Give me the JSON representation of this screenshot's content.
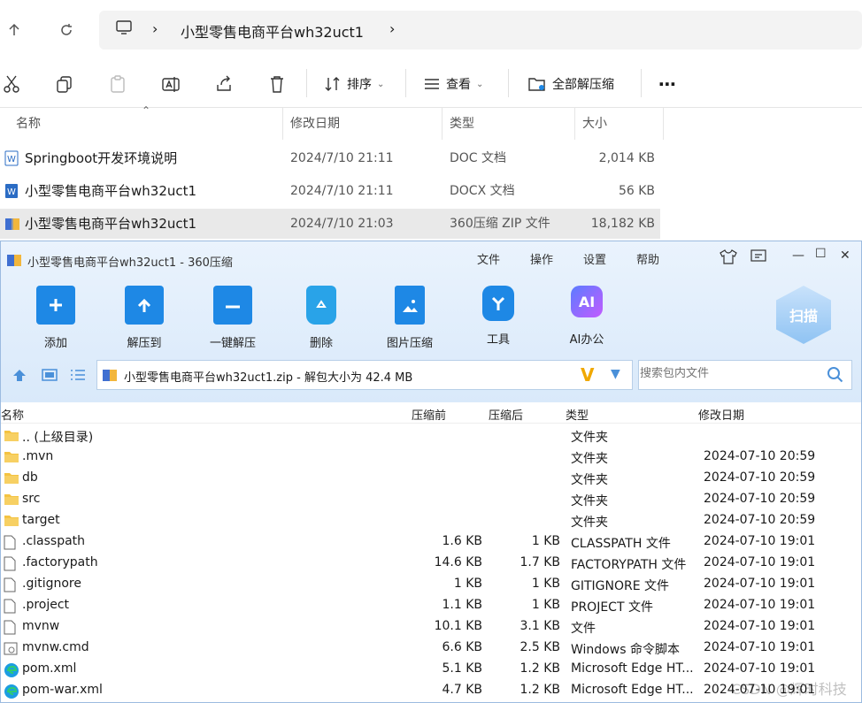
{
  "nav": {
    "path": [
      "小型零售电商平台wh32uct1"
    ]
  },
  "toolbar": {
    "sort_label": "排序",
    "view_label": "查看",
    "extract_all_label": "全部解压缩"
  },
  "header": {
    "name": "名称",
    "date": "修改日期",
    "type": "类型",
    "size": "大小"
  },
  "files": [
    {
      "name": "Springboot开发环境说明",
      "date": "2024/7/10 21:11",
      "type": "DOC 文档",
      "size": "2,014 KB",
      "icon": "word-doc-icon"
    },
    {
      "name": "小型零售电商平台wh32uct1",
      "date": "2024/7/10 21:11",
      "type": "DOCX 文档",
      "size": "56 KB",
      "icon": "word-docx-icon"
    },
    {
      "name": "小型零售电商平台wh32uct1",
      "date": "2024/7/10 21:03",
      "type": "360压缩 ZIP 文件",
      "size": "18,182 KB",
      "icon": "zip-icon"
    }
  ],
  "zipwin": {
    "title": "小型零售电商平台wh32uct1 - 360压缩",
    "menus": [
      "文件",
      "操作",
      "设置",
      "帮助"
    ],
    "tools": [
      "添加",
      "解压到",
      "一键解压",
      "删除",
      "图片压缩",
      "工具",
      "AI办公"
    ],
    "scan_label": "扫描",
    "ai_icon_text": "AI",
    "path_text": "小型零售电商平台wh32uct1.zip - 解包大小为 42.4 MB",
    "search_placeholder": "搜索包内文件",
    "columns": {
      "name": "名称",
      "compressed": "压缩前",
      "original": "压缩后",
      "type": "类型",
      "date": "修改日期"
    },
    "rows": [
      {
        "name": ".. (上级目录)",
        "compressed": "",
        "original": "",
        "type": "文件夹",
        "date": "",
        "icon": "folder-icon"
      },
      {
        "name": ".mvn",
        "compressed": "",
        "original": "",
        "type": "文件夹",
        "date": "2024-07-10 20:59",
        "icon": "folder-icon"
      },
      {
        "name": "db",
        "compressed": "",
        "original": "",
        "type": "文件夹",
        "date": "2024-07-10 20:59",
        "icon": "folder-icon"
      },
      {
        "name": "src",
        "compressed": "",
        "original": "",
        "type": "文件夹",
        "date": "2024-07-10 20:59",
        "icon": "folder-icon"
      },
      {
        "name": "target",
        "compressed": "",
        "original": "",
        "type": "文件夹",
        "date": "2024-07-10 20:59",
        "icon": "folder-icon"
      },
      {
        "name": ".classpath",
        "compressed": "1.6 KB",
        "original": "1 KB",
        "type": "CLASSPATH 文件",
        "date": "2024-07-10 19:01",
        "icon": "file-icon"
      },
      {
        "name": ".factorypath",
        "compressed": "14.6 KB",
        "original": "1.7 KB",
        "type": "FACTORYPATH 文件",
        "date": "2024-07-10 19:01",
        "icon": "file-icon"
      },
      {
        "name": ".gitignore",
        "compressed": "1 KB",
        "original": "1 KB",
        "type": "GITIGNORE 文件",
        "date": "2024-07-10 19:01",
        "icon": "file-icon"
      },
      {
        "name": ".project",
        "compressed": "1.1 KB",
        "original": "1 KB",
        "type": "PROJECT 文件",
        "date": "2024-07-10 19:01",
        "icon": "file-icon"
      },
      {
        "name": "mvnw",
        "compressed": "10.1 KB",
        "original": "3.1 KB",
        "type": "文件",
        "date": "2024-07-10 19:01",
        "icon": "file-icon"
      },
      {
        "name": "mvnw.cmd",
        "compressed": "6.6 KB",
        "original": "2.5 KB",
        "type": "Windows 命令脚本",
        "date": "2024-07-10 19:01",
        "icon": "cmd-file-icon"
      },
      {
        "name": "pom.xml",
        "compressed": "5.1 KB",
        "original": "1.2 KB",
        "type": "Microsoft Edge HT...",
        "date": "2024-07-10 19:01",
        "icon": "edge-icon"
      },
      {
        "name": "pom-war.xml",
        "compressed": "4.7 KB",
        "original": "1.2 KB",
        "type": "Microsoft Edge HT...",
        "date": "2024-07-10 19:01",
        "icon": "edge-icon"
      }
    ]
  },
  "watermark": "CSDN @辉时科技",
  "colors": {
    "accent": "#1e88e5",
    "zip_chrome": "#dbeafb",
    "selected_row": "#e9e9e9"
  }
}
